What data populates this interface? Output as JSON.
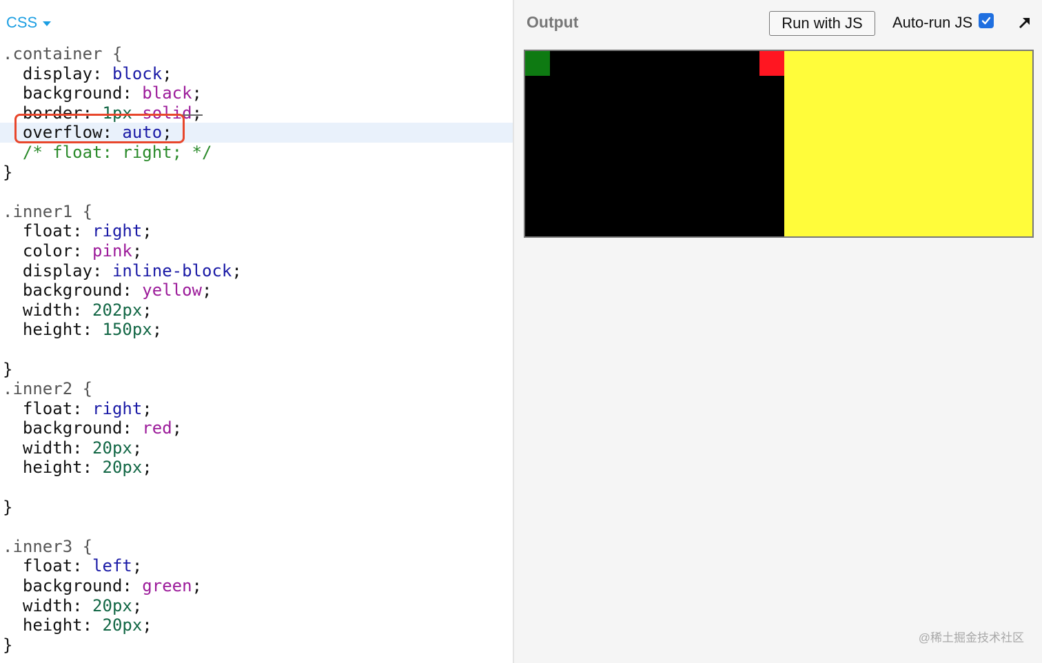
{
  "editor": {
    "language_tab": "CSS",
    "lines": [
      [
        {
          "t": ".container {",
          "c": "sel"
        }
      ],
      [
        {
          "t": "  display: ",
          "c": "prop"
        },
        {
          "t": "block",
          "c": "kw"
        },
        {
          "t": ";",
          "c": "prop"
        }
      ],
      [
        {
          "t": "  background: ",
          "c": "prop"
        },
        {
          "t": "black",
          "c": "col"
        },
        {
          "t": ";",
          "c": "prop"
        }
      ],
      [
        {
          "t": "  border: ",
          "c": "prop"
        },
        {
          "t": "1px",
          "c": "num"
        },
        {
          "t": " ",
          "c": "prop"
        },
        {
          "t": "solid",
          "c": "col"
        },
        {
          "t": ";",
          "c": "prop"
        }
      ],
      [
        {
          "t": "  overflow: ",
          "c": "prop"
        },
        {
          "t": "auto",
          "c": "kw"
        },
        {
          "t": ";",
          "c": "prop"
        }
      ],
      [
        {
          "t": "  /* float: right; */",
          "c": "cmt"
        }
      ],
      [
        {
          "t": "}",
          "c": "prop"
        }
      ],
      [],
      [
        {
          "t": ".inner1 {",
          "c": "sel"
        }
      ],
      [
        {
          "t": "  float: ",
          "c": "prop"
        },
        {
          "t": "right",
          "c": "kw"
        },
        {
          "t": ";",
          "c": "prop"
        }
      ],
      [
        {
          "t": "  color: ",
          "c": "prop"
        },
        {
          "t": "pink",
          "c": "col"
        },
        {
          "t": ";",
          "c": "prop"
        }
      ],
      [
        {
          "t": "  display: ",
          "c": "prop"
        },
        {
          "t": "inline-block",
          "c": "kw"
        },
        {
          "t": ";",
          "c": "prop"
        }
      ],
      [
        {
          "t": "  background: ",
          "c": "prop"
        },
        {
          "t": "yellow",
          "c": "col"
        },
        {
          "t": ";",
          "c": "prop"
        }
      ],
      [
        {
          "t": "  width: ",
          "c": "prop"
        },
        {
          "t": "202px",
          "c": "num"
        },
        {
          "t": ";",
          "c": "prop"
        }
      ],
      [
        {
          "t": "  height: ",
          "c": "prop"
        },
        {
          "t": "150px",
          "c": "num"
        },
        {
          "t": ";",
          "c": "prop"
        }
      ],
      [],
      [
        {
          "t": "}",
          "c": "prop"
        }
      ],
      [
        {
          "t": ".inner2 {",
          "c": "sel"
        }
      ],
      [
        {
          "t": "  float: ",
          "c": "prop"
        },
        {
          "t": "right",
          "c": "kw"
        },
        {
          "t": ";",
          "c": "prop"
        }
      ],
      [
        {
          "t": "  background: ",
          "c": "prop"
        },
        {
          "t": "red",
          "c": "col"
        },
        {
          "t": ";",
          "c": "prop"
        }
      ],
      [
        {
          "t": "  width: ",
          "c": "prop"
        },
        {
          "t": "20px",
          "c": "num"
        },
        {
          "t": ";",
          "c": "prop"
        }
      ],
      [
        {
          "t": "  height: ",
          "c": "prop"
        },
        {
          "t": "20px",
          "c": "num"
        },
        {
          "t": ";",
          "c": "prop"
        }
      ],
      [],
      [
        {
          "t": "}",
          "c": "prop"
        }
      ],
      [],
      [
        {
          "t": ".inner3 {",
          "c": "sel"
        }
      ],
      [
        {
          "t": "  float: ",
          "c": "prop"
        },
        {
          "t": "left",
          "c": "kw"
        },
        {
          "t": ";",
          "c": "prop"
        }
      ],
      [
        {
          "t": "  background: ",
          "c": "prop"
        },
        {
          "t": "green",
          "c": "col"
        },
        {
          "t": ";",
          "c": "prop"
        }
      ],
      [
        {
          "t": "  width: ",
          "c": "prop"
        },
        {
          "t": "20px",
          "c": "num"
        },
        {
          "t": ";",
          "c": "prop"
        }
      ],
      [
        {
          "t": "  height: ",
          "c": "prop"
        },
        {
          "t": "20px",
          "c": "num"
        },
        {
          "t": ";",
          "c": "prop"
        }
      ],
      [
        {
          "t": "}",
          "c": "prop"
        }
      ]
    ]
  },
  "output": {
    "label": "Output",
    "run_button": "Run with JS",
    "autorun_label": "Auto-run JS",
    "autorun_checked": true
  },
  "colors": {
    "accent": "#1b9ee2",
    "highlight_box": "#e8462b",
    "render_black": "#000000",
    "render_yellow": "#fffc3a",
    "render_red": "#ff1621",
    "render_green": "#0e7a12"
  },
  "watermark": "@稀土掘金技术社区"
}
